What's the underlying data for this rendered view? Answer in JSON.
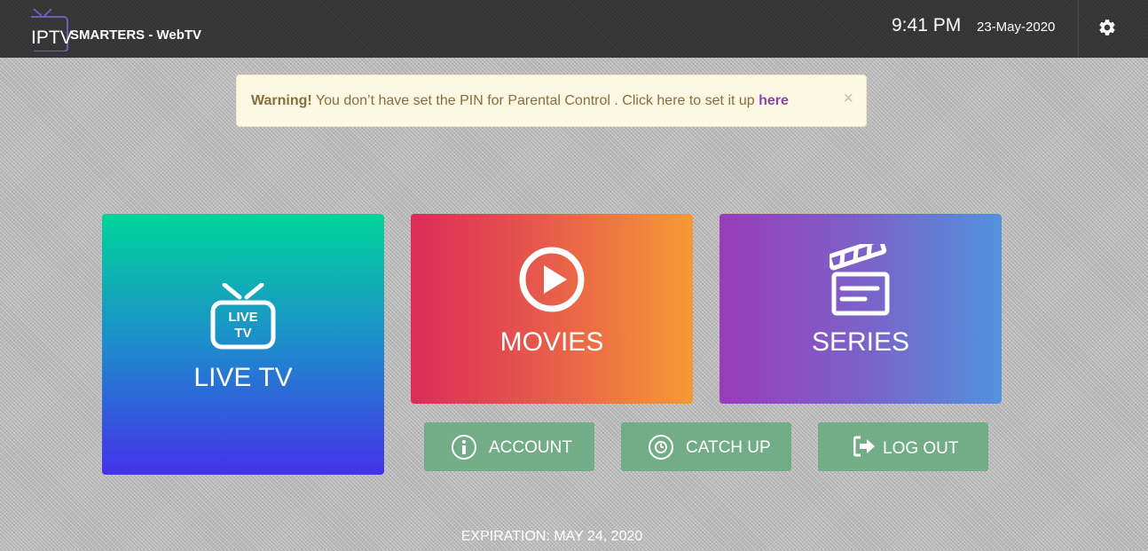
{
  "header": {
    "logo": {
      "iptv": "IPTV",
      "smarters": "SMARTERS - WebTV"
    },
    "time": "9:41 PM",
    "date": "23-May-2020",
    "settings_icon": "gear-icon"
  },
  "warning": {
    "strong": "Warning!",
    "message": " You don’t have set the PIN for Parental Control . Click here to set it up ",
    "link": "here",
    "close": "×"
  },
  "tiles": {
    "live_tv": {
      "label": "LIVE TV",
      "icon": "live-tv-icon",
      "icon_text_1": "LIVE",
      "icon_text_2": "TV"
    },
    "movies": {
      "label": "MOVIES",
      "icon": "play-icon"
    },
    "series": {
      "label": "SERIES",
      "icon": "clapperboard-icon"
    }
  },
  "buttons": {
    "account": {
      "label": "ACCOUNT",
      "icon": "info-icon"
    },
    "catch_up": {
      "label": "CATCH UP",
      "icon": "clock-icon"
    },
    "log_out": {
      "label": "LOG OUT",
      "icon": "sign-out-icon"
    }
  },
  "footer": {
    "expiration": "EXPIRATION: MAY 24, 2020"
  },
  "colors": {
    "header_bg": "#343434",
    "warning_bg": "#fcf8e3",
    "warning_text": "#8a6d3b",
    "warning_link": "#8e44ad",
    "button_bg": "#72ad87",
    "live_tv_gradient": [
      "#00d59a",
      "#4431ea"
    ],
    "movies_gradient": [
      "#dc2c58",
      "#f69a35"
    ],
    "series_gradient": [
      "#9a3cbb",
      "#5292dc"
    ]
  }
}
